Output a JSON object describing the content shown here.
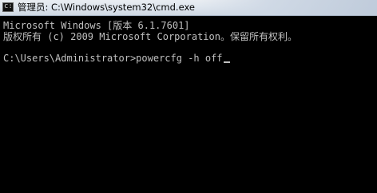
{
  "window": {
    "title": "管理员: C:\\Windows\\system32\\cmd.exe",
    "icon": "cmd-icon"
  },
  "console": {
    "lines": [
      "Microsoft Windows [版本 6.1.7601]",
      "版权所有 (c) 2009 Microsoft Corporation。保留所有权利。",
      "C:\\Users\\Administrator>powercfg -h off"
    ],
    "colors": {
      "background": "#000000",
      "text": "#c0c0c0"
    }
  }
}
